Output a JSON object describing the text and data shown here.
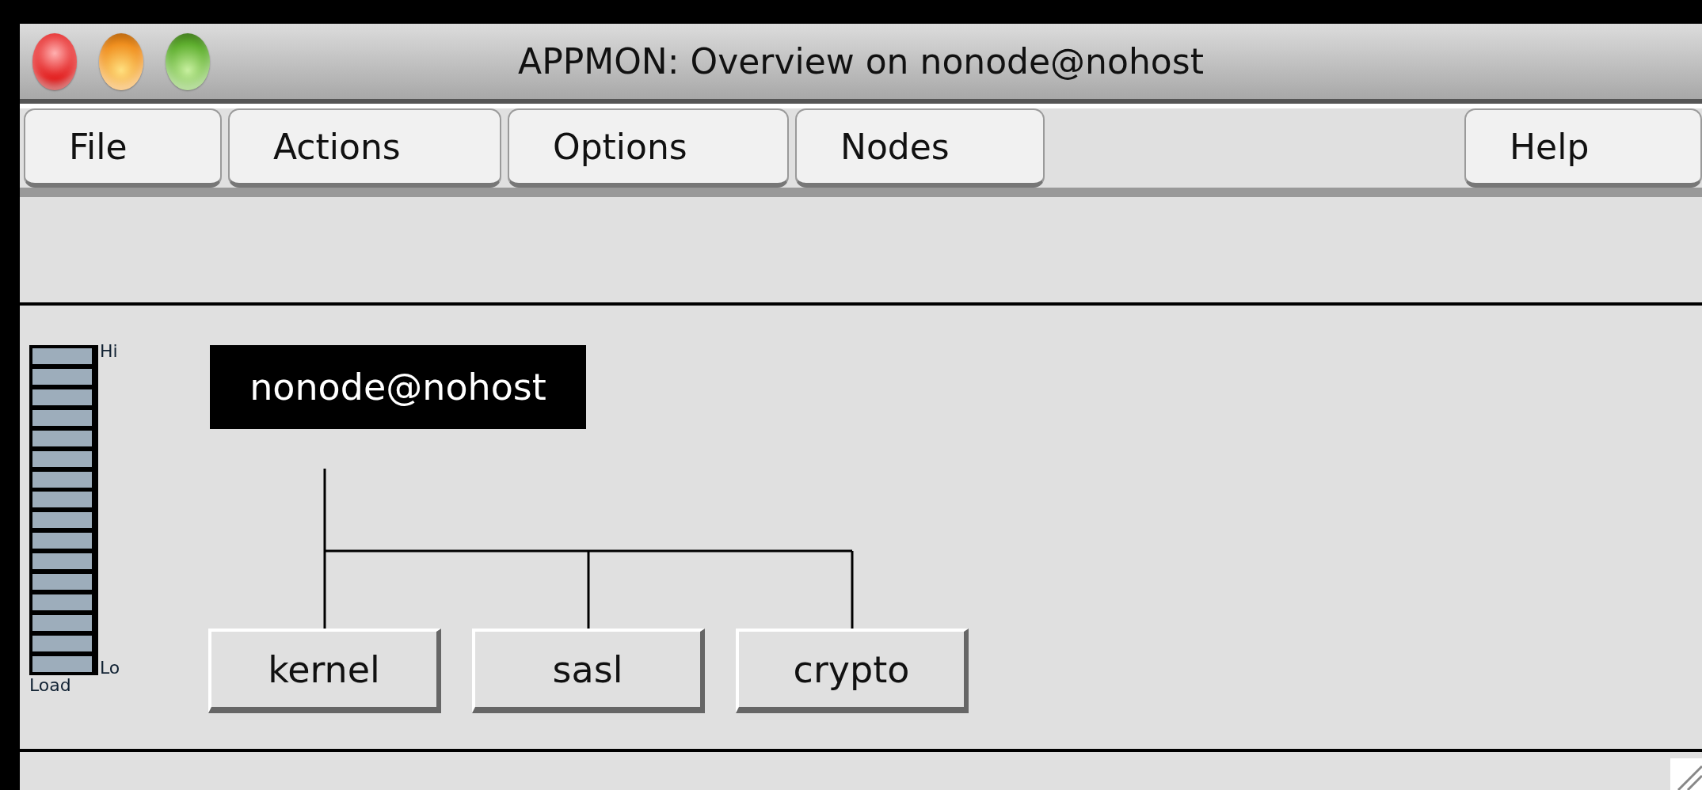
{
  "window": {
    "title": "APPMON: Overview on nonode@nohost"
  },
  "menus": [
    {
      "label": "File"
    },
    {
      "label": "Actions"
    },
    {
      "label": "Options"
    },
    {
      "label": "Nodes"
    }
  ],
  "help_menu": {
    "label": "Help"
  },
  "load_meter": {
    "hi_label": "Hi",
    "lo_label": "Lo",
    "caption": "Load"
  },
  "node": {
    "name": "nonode@nohost"
  },
  "applications": [
    {
      "name": "kernel"
    },
    {
      "name": "sasl"
    },
    {
      "name": "crypto"
    }
  ]
}
